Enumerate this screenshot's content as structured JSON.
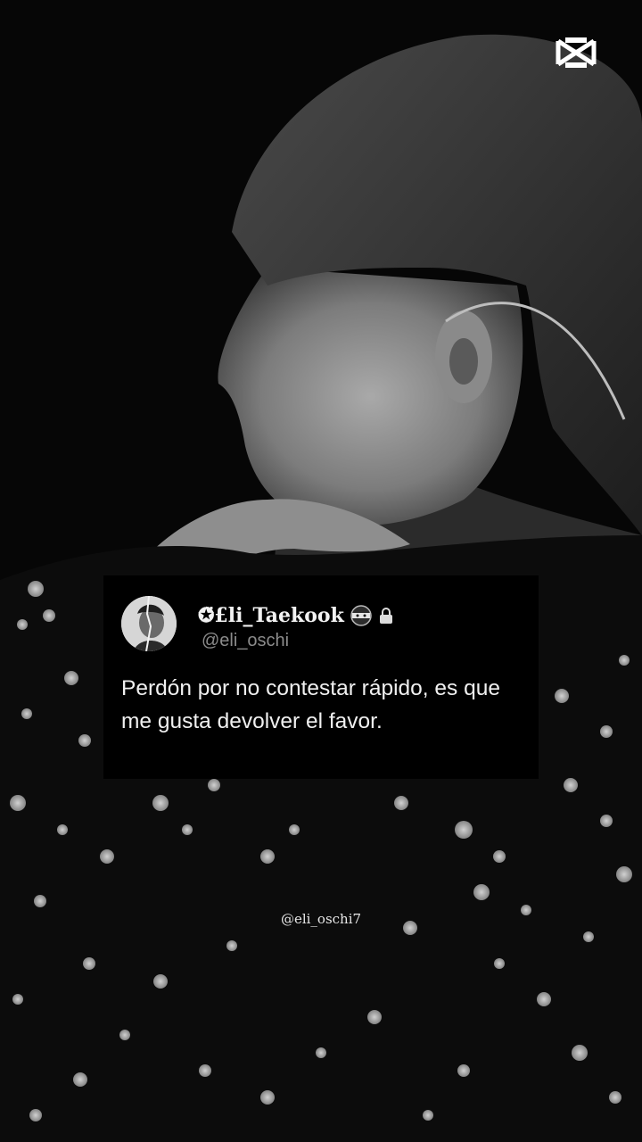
{
  "app": {
    "logo_icon": "capcut-logo-icon"
  },
  "tweet": {
    "display_name": "✪̈£li_Taekook",
    "name_emoji_icon": "ninja-icon",
    "protected_icon": "lock-icon",
    "handle": "@eli_oschi",
    "text": "Perdón por no contestar rápido, es que me gusta devolver el favor."
  },
  "overlay": {
    "watermark": "@eli_oschi7"
  },
  "colors": {
    "card_bg": "#000000",
    "text_primary": "#f0f0f0",
    "text_secondary": "#8b8b8b"
  }
}
